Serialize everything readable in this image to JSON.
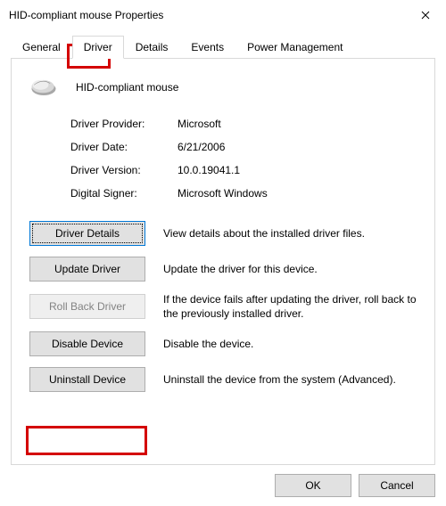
{
  "window": {
    "title": "HID-compliant mouse Properties"
  },
  "tabs": [
    "General",
    "Driver",
    "Details",
    "Events",
    "Power Management"
  ],
  "active_tab": "Driver",
  "device": {
    "name": "HID-compliant mouse"
  },
  "info": {
    "provider_label": "Driver Provider:",
    "provider_value": "Microsoft",
    "date_label": "Driver Date:",
    "date_value": "6/21/2006",
    "version_label": "Driver Version:",
    "version_value": "10.0.19041.1",
    "signer_label": "Digital Signer:",
    "signer_value": "Microsoft Windows"
  },
  "actions": {
    "details": {
      "label": "Driver Details",
      "desc": "View details about the installed driver files."
    },
    "update": {
      "label": "Update Driver",
      "desc": "Update the driver for this device."
    },
    "rollback": {
      "label": "Roll Back Driver",
      "desc": "If the device fails after updating the driver, roll back to the previously installed driver."
    },
    "disable": {
      "label": "Disable Device",
      "desc": "Disable the device."
    },
    "uninstall": {
      "label": "Uninstall Device",
      "desc": "Uninstall the device from the system (Advanced)."
    }
  },
  "footer": {
    "ok": "OK",
    "cancel": "Cancel"
  }
}
